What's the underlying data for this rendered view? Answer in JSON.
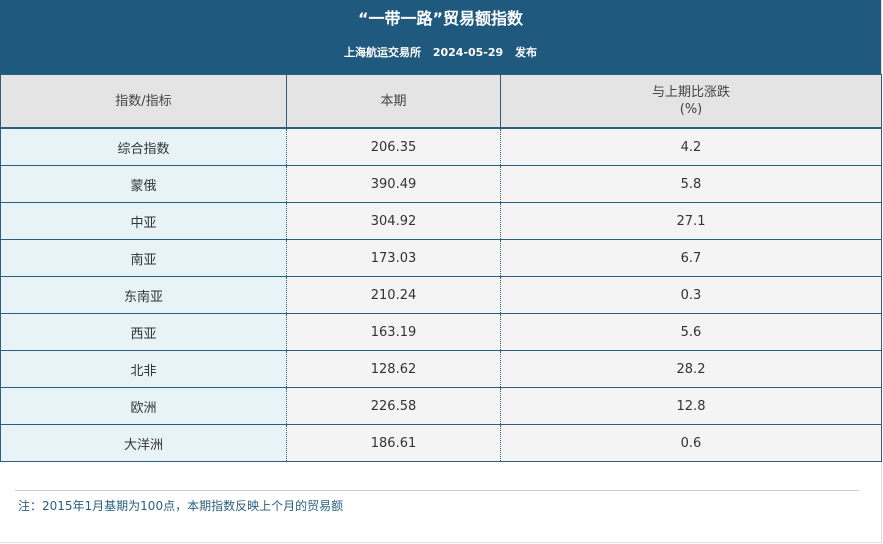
{
  "header": {
    "title": "“一带一路”贸易额指数",
    "publisher": "上海航运交易所",
    "date": "2024-05-29",
    "publish_label": "发布"
  },
  "table": {
    "columns": [
      "指数/指标",
      "本期",
      "与上期比涨跌",
      "(%)"
    ],
    "rows": [
      {
        "name": "综合指数",
        "current": "206.35",
        "change": "4.2"
      },
      {
        "name": "蒙俄",
        "current": "390.49",
        "change": "5.8"
      },
      {
        "name": "中亚",
        "current": "304.92",
        "change": "27.1"
      },
      {
        "name": "南亚",
        "current": "173.03",
        "change": "6.7"
      },
      {
        "name": "东南亚",
        "current": "210.24",
        "change": "0.3"
      },
      {
        "name": "西亚",
        "current": "163.19",
        "change": "5.6"
      },
      {
        "name": "北非",
        "current": "128.62",
        "change": "28.2"
      },
      {
        "name": "欧洲",
        "current": "226.58",
        "change": "12.8"
      },
      {
        "name": "大洋洲",
        "current": "186.61",
        "change": "0.6"
      }
    ]
  },
  "footer": {
    "note": "注：2015年1月基期为100点，本期指数反映上个月的贸易额"
  },
  "colors": {
    "header_bg": "#1f5a7e",
    "name_cell_bg": "#e8f3f8",
    "value_cell_bg": "#f4f4f4",
    "note_text": "#2a5f80"
  }
}
